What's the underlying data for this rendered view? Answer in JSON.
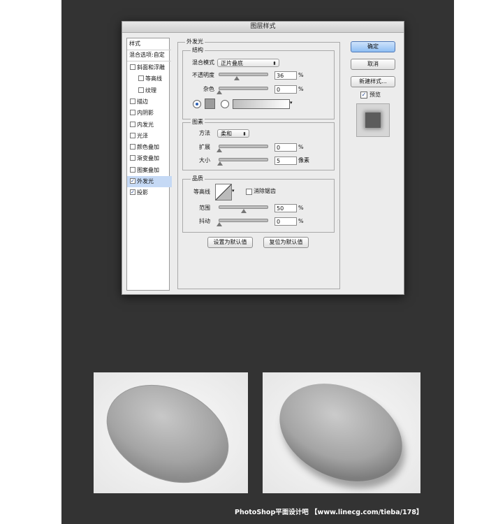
{
  "dialog": {
    "title": "图层样式",
    "left_panel": {
      "header_styles": "样式",
      "header_blending": "混合选项:自定",
      "items": [
        {
          "label": "斜面和浮雕",
          "checked": false,
          "indent": false
        },
        {
          "label": "等高线",
          "checked": false,
          "indent": true
        },
        {
          "label": "纹理",
          "checked": false,
          "indent": true
        },
        {
          "label": "描边",
          "checked": false,
          "indent": false
        },
        {
          "label": "内阴影",
          "checked": false,
          "indent": false
        },
        {
          "label": "内发光",
          "checked": false,
          "indent": false
        },
        {
          "label": "光泽",
          "checked": false,
          "indent": false
        },
        {
          "label": "颜色叠加",
          "checked": false,
          "indent": false
        },
        {
          "label": "渐变叠加",
          "checked": false,
          "indent": false
        },
        {
          "label": "图案叠加",
          "checked": false,
          "indent": false
        },
        {
          "label": "外发光",
          "checked": true,
          "indent": false,
          "selected": true
        },
        {
          "label": "投影",
          "checked": true,
          "indent": false
        }
      ]
    },
    "outer_glow": {
      "title": "外发光",
      "structure": {
        "title": "结构",
        "blend_mode_label": "混合模式",
        "blend_mode_value": "正片叠底",
        "opacity_label": "不透明度",
        "opacity_value": "36",
        "opacity_fraction": 0.36,
        "noise_label": "杂色",
        "noise_value": "0",
        "noise_fraction": 0.0,
        "pct": "%",
        "color_swatch": "#9c9c9c"
      },
      "elements": {
        "title": "图素",
        "method_label": "方法",
        "method_value": "柔和",
        "spread_label": "扩展",
        "spread_value": "0",
        "spread_fraction": 0.0,
        "size_label": "大小",
        "size_value": "5",
        "size_fraction": 0.02,
        "pct": "%",
        "px": "像素"
      },
      "quality": {
        "title": "品质",
        "contour_label": "等高线",
        "antialias_label": "消除锯齿",
        "range_label": "范围",
        "range_value": "50",
        "range_fraction": 0.5,
        "jitter_label": "抖动",
        "jitter_value": "0",
        "jitter_fraction": 0.0,
        "pct": "%"
      },
      "make_default": "设置为默认值",
      "reset_default": "复位为默认值"
    },
    "buttons": {
      "ok": "确定",
      "cancel": "取消",
      "new_style": "新建样式...",
      "preview": "预览"
    }
  },
  "footer": "PhotoShop平面设计吧 【www.linecg.com/tieba/178】"
}
